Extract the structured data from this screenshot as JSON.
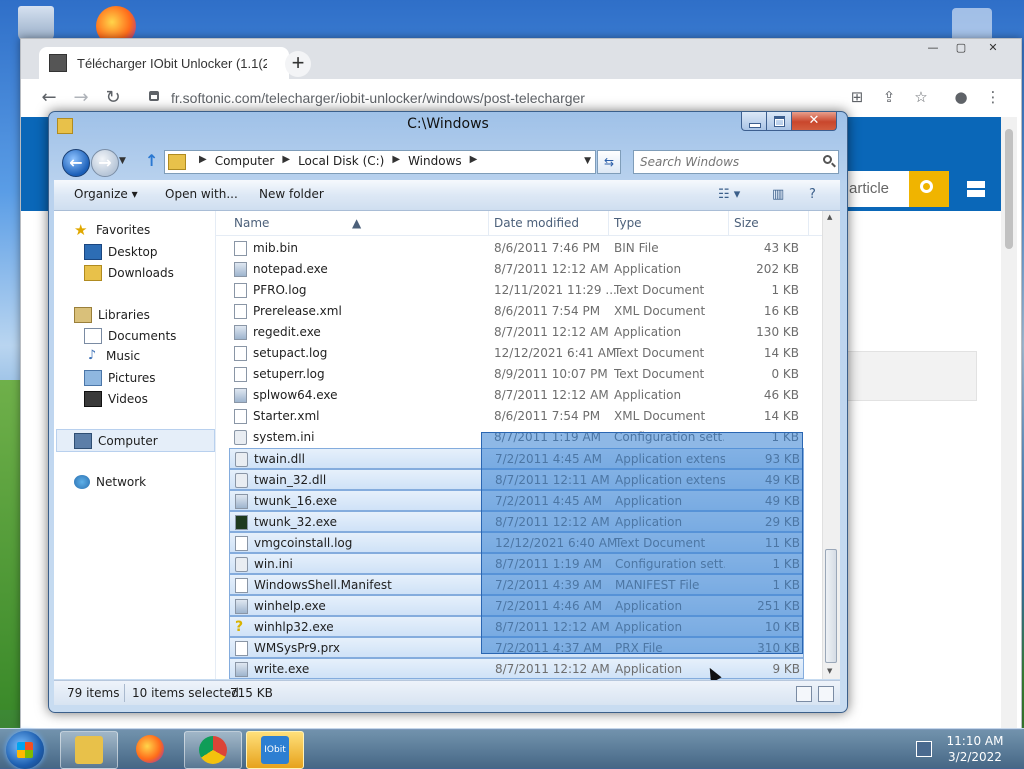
{
  "browser": {
    "tab_title": "Télécharger IObit Unlocker (1.1(2",
    "new_tab": "+",
    "url": "fr.softonic.com/telecharger/iobit-unlocker/windows/post-telecharger",
    "site_search_text": "article",
    "controls": {
      "minimize": "—",
      "maximize": "▢",
      "close": "✕"
    }
  },
  "explorer": {
    "title": "C:\\Windows",
    "breadcrumbs": [
      "Computer",
      "Local Disk (C:)",
      "Windows"
    ],
    "search_placeholder": "Search Windows",
    "toolbar": {
      "organize": "Organize ▾",
      "open_with": "Open with...",
      "new_folder": "New folder"
    },
    "nav": {
      "favorites": "Favorites",
      "desktop": "Desktop",
      "downloads": "Downloads",
      "libraries": "Libraries",
      "documents": "Documents",
      "music": "Music",
      "pictures": "Pictures",
      "videos": "Videos",
      "computer": "Computer",
      "network": "Network"
    },
    "columns": {
      "name": "Name",
      "date": "Date modified",
      "type": "Type",
      "size": "Size"
    },
    "files": [
      {
        "name": "mib.bin",
        "date": "8/6/2011 7:46 PM",
        "type": "BIN File",
        "size": "43 KB",
        "icon": "file-icon",
        "selected": false
      },
      {
        "name": "notepad.exe",
        "date": "8/7/2011 12:12 AM",
        "type": "Application",
        "size": "202 KB",
        "icon": "exe-icon",
        "selected": false
      },
      {
        "name": "PFRO.log",
        "date": "12/11/2021 11:29 ...",
        "type": "Text Document",
        "size": "1 KB",
        "icon": "file-icon",
        "selected": false
      },
      {
        "name": "Prerelease.xml",
        "date": "8/6/2011 7:54 PM",
        "type": "XML Document",
        "size": "16 KB",
        "icon": "file-icon",
        "selected": false
      },
      {
        "name": "regedit.exe",
        "date": "8/7/2011 12:12 AM",
        "type": "Application",
        "size": "130 KB",
        "icon": "exe-icon",
        "selected": false
      },
      {
        "name": "setupact.log",
        "date": "12/12/2021 6:41 AM",
        "type": "Text Document",
        "size": "14 KB",
        "icon": "file-icon",
        "selected": false
      },
      {
        "name": "setuperr.log",
        "date": "8/9/2011 10:07 PM",
        "type": "Text Document",
        "size": "0 KB",
        "icon": "file-icon",
        "selected": false
      },
      {
        "name": "splwow64.exe",
        "date": "8/7/2011 12:12 AM",
        "type": "Application",
        "size": "46 KB",
        "icon": "exe-icon",
        "selected": false
      },
      {
        "name": "Starter.xml",
        "date": "8/6/2011 7:54 PM",
        "type": "XML Document",
        "size": "14 KB",
        "icon": "file-icon",
        "selected": false
      },
      {
        "name": "system.ini",
        "date": "8/7/2011 1:19 AM",
        "type": "Configuration sett...",
        "size": "1 KB",
        "icon": "gear-icon",
        "selected": false
      },
      {
        "name": "twain.dll",
        "date": "7/2/2011 4:45 AM",
        "type": "Application extens...",
        "size": "93 KB",
        "icon": "gear-icon",
        "selected": true
      },
      {
        "name": "twain_32.dll",
        "date": "8/7/2011 12:11 AM",
        "type": "Application extens...",
        "size": "49 KB",
        "icon": "gear-icon",
        "selected": true
      },
      {
        "name": "twunk_16.exe",
        "date": "7/2/2011 4:45 AM",
        "type": "Application",
        "size": "49 KB",
        "icon": "exe-icon",
        "selected": true
      },
      {
        "name": "twunk_32.exe",
        "date": "8/7/2011 12:12 AM",
        "type": "Application",
        "size": "29 KB",
        "icon": "dark-exe-icon",
        "selected": true
      },
      {
        "name": "vmgcoinstall.log",
        "date": "12/12/2021 6:40 AM",
        "type": "Text Document",
        "size": "11 KB",
        "icon": "file-icon",
        "selected": true
      },
      {
        "name": "win.ini",
        "date": "8/7/2011 1:19 AM",
        "type": "Configuration sett...",
        "size": "1 KB",
        "icon": "gear-icon",
        "selected": true
      },
      {
        "name": "WindowsShell.Manifest",
        "date": "7/2/2011 4:39 AM",
        "type": "MANIFEST File",
        "size": "1 KB",
        "icon": "file-icon",
        "selected": true
      },
      {
        "name": "winhelp.exe",
        "date": "7/2/2011 4:46 AM",
        "type": "Application",
        "size": "251 KB",
        "icon": "exe-icon",
        "selected": true
      },
      {
        "name": "winhlp32.exe",
        "date": "8/7/2011 12:12 AM",
        "type": "Application",
        "size": "10 KB",
        "icon": "help-icon",
        "selected": true
      },
      {
        "name": "WMSysPr9.prx",
        "date": "7/2/2011 4:37 AM",
        "type": "PRX File",
        "size": "310 KB",
        "icon": "file-icon",
        "selected": true
      },
      {
        "name": "write.exe",
        "date": "8/7/2011 12:12 AM",
        "type": "Application",
        "size": "9 KB",
        "icon": "exe-icon",
        "selected": true
      }
    ],
    "status": {
      "count": "79 items",
      "selected": "10 items selected",
      "size": "715 KB"
    }
  },
  "taskbar": {
    "clock_time": "11:10 AM",
    "clock_date": "3/2/2022",
    "pinned_label": "IObit"
  }
}
